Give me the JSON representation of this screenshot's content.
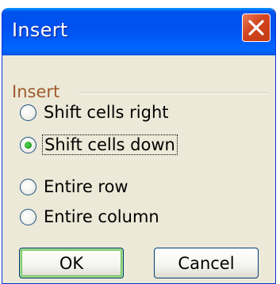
{
  "dialog": {
    "title": "Insert",
    "group_label": "Insert",
    "options": [
      {
        "label": "Shift cells right",
        "checked": false
      },
      {
        "label": "Shift cells down",
        "checked": true
      },
      {
        "label": "Entire row",
        "checked": false
      },
      {
        "label": "Entire column",
        "checked": false
      }
    ],
    "ok_label": "OK",
    "cancel_label": "Cancel"
  },
  "colors": {
    "titlebar": "#0054e3",
    "dialog_bg": "#ece9d8",
    "close_button": "#d2441d",
    "group_label": "#a05a2c",
    "radio_dot": "#21a121"
  },
  "icons": {
    "close": "close-icon"
  }
}
